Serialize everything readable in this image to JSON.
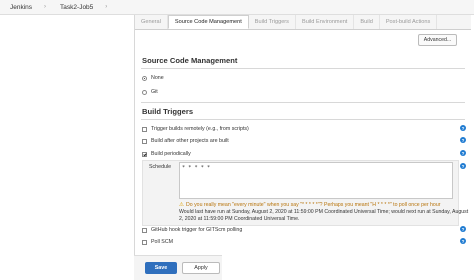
{
  "breadcrumb": {
    "root": "Jenkins",
    "sep": "›",
    "job": "Task2-Job5"
  },
  "tabs": [
    "General",
    "Source Code Management",
    "Build Triggers",
    "Build Environment",
    "Build",
    "Post-build Actions"
  ],
  "advanced_label": "Advanced...",
  "scm": {
    "title": "Source Code Management",
    "options": [
      "None",
      "Git"
    ],
    "selected": "None"
  },
  "triggers": {
    "title": "Build Triggers",
    "items": [
      {
        "label": "Trigger builds remotely (e.g., from scripts)",
        "checked": false
      },
      {
        "label": "Build after other projects are built",
        "checked": false
      },
      {
        "label": "Build periodically",
        "checked": true
      },
      {
        "label": "GitHub hook trigger for GITScm polling",
        "checked": false
      },
      {
        "label": "Poll SCM",
        "checked": false
      }
    ],
    "schedule_label": "Schedule",
    "schedule_value": "* * * * *",
    "warning": "Do you really mean \"every minute\" when you say \"* * * * *\"? Perhaps you meant \"H * * * *\" to poll once per hour",
    "info": "Would last have run at Sunday, August 2, 2020 at 11:59:00 PM Coordinated Universal Time; would next run at Sunday, August 2, 2020 at 11:59:00 PM Coordinated Universal Time."
  },
  "buttons": {
    "save": "Save",
    "apply": "Apply"
  },
  "colors": {
    "accent": "#2f6fbd",
    "help": "#1f7bd1",
    "warning": "#b7730a"
  }
}
